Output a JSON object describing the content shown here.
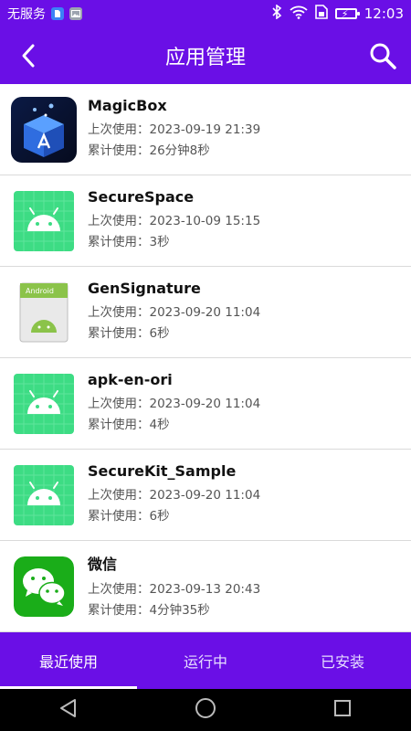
{
  "status_bar": {
    "carrier": "无服务",
    "time": "12:03",
    "icons": [
      "sim-badge-icon",
      "image-badge-icon",
      "bluetooth-icon",
      "wifi-icon",
      "sim-card-icon",
      "battery-charging-icon"
    ]
  },
  "header": {
    "title": "应用管理",
    "back_icon": "back-arrow-icon",
    "search_icon": "search-icon"
  },
  "labels": {
    "last_used": "上次使用：",
    "total_used": "累计使用："
  },
  "apps": [
    {
      "name": "MagicBox",
      "last_used": "2023-09-19 21:39",
      "total_used": "26分钟8秒",
      "icon": "magicbox-icon"
    },
    {
      "name": "SecureSpace",
      "last_used": "2023-10-09 15:15",
      "total_used": "3秒",
      "icon": "android-icon"
    },
    {
      "name": "GenSignature",
      "last_used": "2023-09-20 11:04",
      "total_used": "6秒",
      "icon": "android-package-icon",
      "icon_text": "Android"
    },
    {
      "name": "apk-en-ori",
      "last_used": "2023-09-20 11:04",
      "total_used": "4秒",
      "icon": "android-icon"
    },
    {
      "name": "SecureKit_Sample",
      "last_used": "2023-09-20 11:04",
      "total_used": "6秒",
      "icon": "android-icon"
    },
    {
      "name": "微信",
      "last_used": "2023-09-13 20:43",
      "total_used": "4分钟35秒",
      "icon": "wechat-icon"
    }
  ],
  "tabs": [
    {
      "label": "最近使用",
      "active": true
    },
    {
      "label": "运行中",
      "active": false
    },
    {
      "label": "已安装",
      "active": false
    }
  ],
  "nav": [
    "back-triangle-icon",
    "home-circle-icon",
    "recents-square-icon"
  ],
  "colors": {
    "accent": "#6a0fe6",
    "android_green": "#3ddc84",
    "wechat_green": "#1aad19"
  }
}
